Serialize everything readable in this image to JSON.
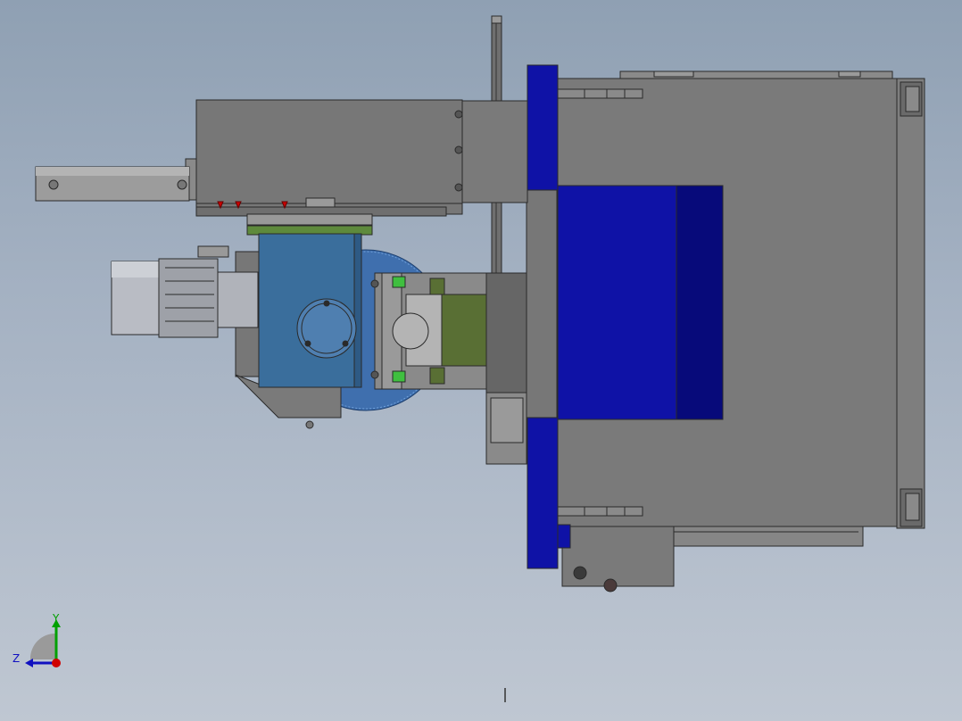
{
  "viewport": {
    "background_top": "#8fa0b3",
    "background_bottom": "#bfc7d2"
  },
  "model": {
    "colors": {
      "housing_gray": "#777777",
      "housing_dark": "#5e5e5e",
      "edge": "#2a2a2a",
      "table_blue": "#0f12a6",
      "table_blue_dark": "#070a7a",
      "gearbox_blue": "#3a6e9c",
      "saw_blade_blue": "#3f6fae",
      "green_plate": "#5e8a3c",
      "green_block": "#596f34",
      "green_pin": "#3fbf3f",
      "motor_silver": "#b9bcc4",
      "marker_red": "#cc0000"
    },
    "parts": [
      "feed-cylinder",
      "gearbox-housing",
      "linear-guide",
      "electric-motor",
      "saw-gearbox",
      "saw-blade",
      "clamp-block",
      "blue-table",
      "main-frame"
    ]
  },
  "triad": {
    "y_label": "Y",
    "z_label": "Z",
    "y_color": "#00a000",
    "z_color": "#1010c0",
    "x_color": "#d00000",
    "icon": "coordinate-triad-icon"
  }
}
